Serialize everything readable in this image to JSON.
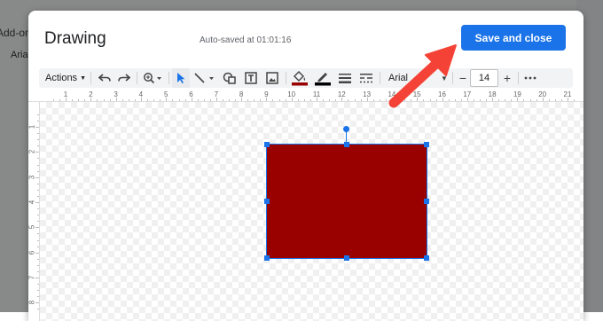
{
  "background": {
    "menu_text": "Add-ons",
    "toolbar_font": "Arial"
  },
  "dialog": {
    "title": "Drawing",
    "autosave": "Auto-saved at 01:01:16",
    "save_button": "Save and close"
  },
  "toolbar": {
    "actions_label": "Actions",
    "font_name": "Arial",
    "font_size": "14",
    "minus": "−",
    "plus": "+",
    "more": "⋮",
    "fill_color": "#990000",
    "line_color": "#000000",
    "icons": [
      "undo-icon",
      "redo-icon",
      "zoom-icon",
      "select-icon",
      "line-icon",
      "shape-icon",
      "textbox-icon",
      "image-icon",
      "fill-color-icon",
      "border-color-icon",
      "border-weight-icon",
      "border-dash-icon",
      "more-icon"
    ]
  },
  "ruler": {
    "horizontal": [
      "1",
      "2",
      "3",
      "4",
      "5",
      "6",
      "7",
      "8",
      "9",
      "10",
      "11",
      "12",
      "13",
      "14",
      "15",
      "16",
      "17",
      "18",
      "19",
      "20",
      "21"
    ],
    "vertical": [
      "1",
      "2",
      "3",
      "4",
      "5",
      "6",
      "7",
      "8"
    ]
  },
  "shape": {
    "type": "rectangle",
    "fill": "#990000",
    "selected": true
  },
  "colors": {
    "accent": "#1a73e8",
    "annotation_arrow": "#f44336"
  }
}
